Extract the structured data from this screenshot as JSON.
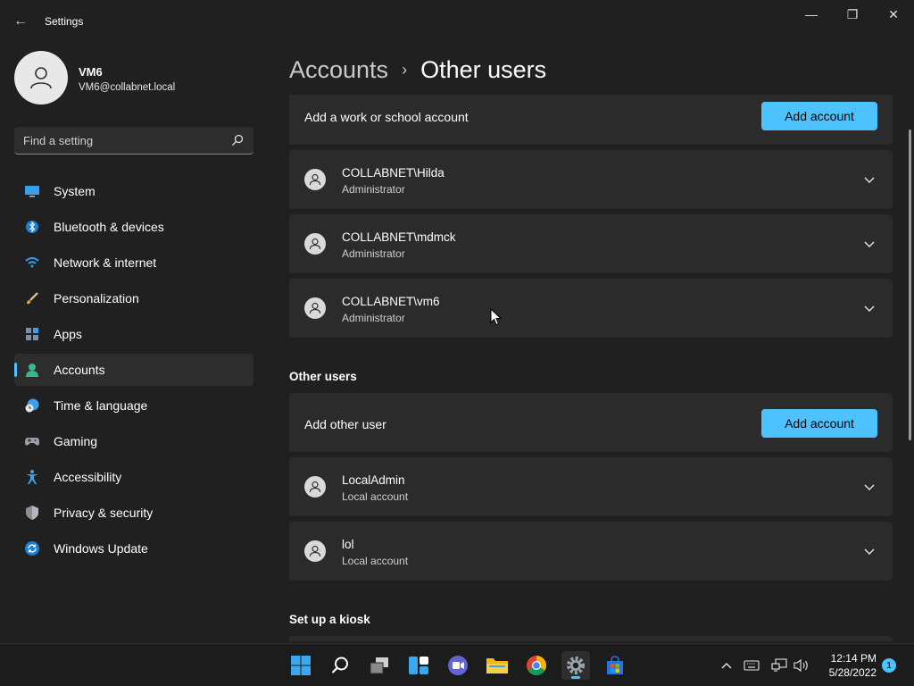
{
  "window": {
    "app_title": "Settings",
    "minimize_glyph": "—",
    "maximize_glyph": "❐",
    "close_glyph": "✕",
    "back_glyph": "←"
  },
  "profile": {
    "name": "VM6",
    "email": "VM6@collabnet.local"
  },
  "search": {
    "placeholder": "Find a setting"
  },
  "nav": {
    "items": [
      {
        "label": "System",
        "icon": "system-icon"
      },
      {
        "label": "Bluetooth & devices",
        "icon": "bluetooth-icon"
      },
      {
        "label": "Network & internet",
        "icon": "wifi-icon"
      },
      {
        "label": "Personalization",
        "icon": "brush-icon"
      },
      {
        "label": "Apps",
        "icon": "apps-icon"
      },
      {
        "label": "Accounts",
        "icon": "accounts-icon",
        "active": true
      },
      {
        "label": "Time & language",
        "icon": "clock-globe-icon"
      },
      {
        "label": "Gaming",
        "icon": "gamepad-icon"
      },
      {
        "label": "Accessibility",
        "icon": "accessibility-icon"
      },
      {
        "label": "Privacy & security",
        "icon": "shield-icon"
      },
      {
        "label": "Windows Update",
        "icon": "update-icon"
      }
    ]
  },
  "breadcrumb": {
    "parent": "Accounts",
    "separator": "›",
    "current": "Other users"
  },
  "work_accounts": {
    "add_label": "Add a work or school account",
    "add_button": "Add account",
    "users": [
      {
        "name": "COLLABNET\\Hilda",
        "role": "Administrator"
      },
      {
        "name": "COLLABNET\\mdmck",
        "role": "Administrator"
      },
      {
        "name": "COLLABNET\\vm6",
        "role": "Administrator"
      }
    ]
  },
  "other_users": {
    "section_title": "Other users",
    "add_label": "Add other user",
    "add_button": "Add account",
    "users": [
      {
        "name": "LocalAdmin",
        "role": "Local account"
      },
      {
        "name": "lol",
        "role": "Local account"
      }
    ]
  },
  "kiosk": {
    "section_title": "Set up a kiosk"
  },
  "taskbar": {
    "apps": [
      "start-icon",
      "search-icon",
      "task-view-icon",
      "widgets-icon",
      "teams-chat-icon",
      "file-explorer-icon",
      "chrome-icon",
      "settings-icon",
      "store-icon"
    ],
    "active_app": "settings-icon",
    "time": "12:14 PM",
    "date": "5/28/2022",
    "notifications": "1"
  },
  "colors": {
    "accent": "#4cc2ff",
    "background": "#202020",
    "card": "#2b2b2b"
  }
}
